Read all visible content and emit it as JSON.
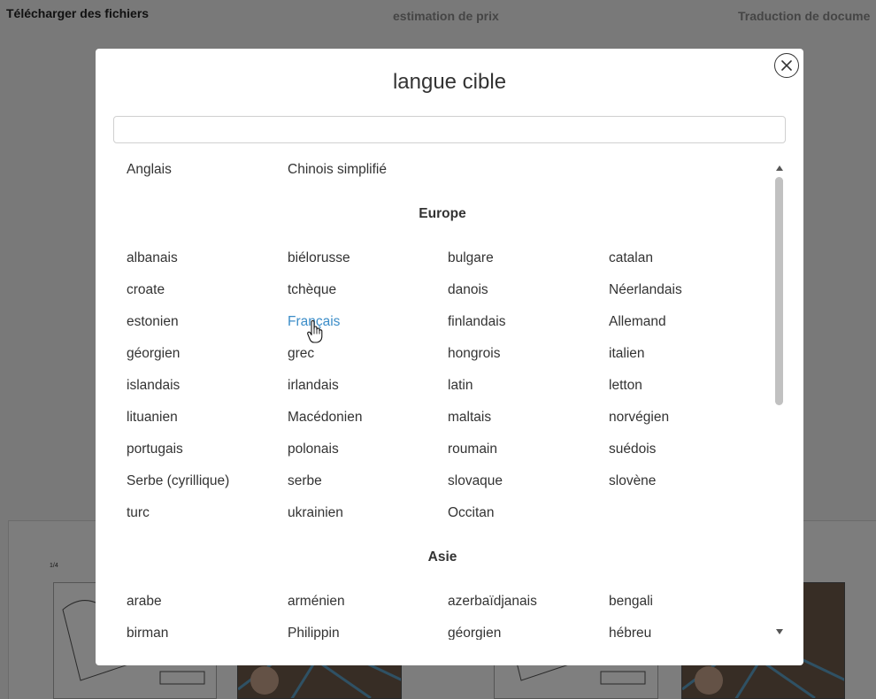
{
  "background": {
    "tabs": [
      "Télécharger des fichiers",
      "estimation de prix",
      "Traduction de docume"
    ],
    "page_number": "1/4"
  },
  "modal": {
    "title": "langue cible",
    "search": {
      "value": "",
      "placeholder": ""
    },
    "close_icon": "close-icon",
    "popular": [
      "Anglais",
      "Chinois simplifié"
    ],
    "sections": [
      {
        "title": "Europe",
        "rows": [
          [
            "albanais",
            "biélorusse",
            "bulgare",
            "catalan"
          ],
          [
            "croate",
            "tchèque",
            "danois",
            "Néerlandais"
          ],
          [
            "estonien",
            "Français",
            "finlandais",
            "Allemand"
          ],
          [
            "géorgien",
            "grec",
            "hongrois",
            "italien"
          ],
          [
            "islandais",
            "irlandais",
            "latin",
            "letton"
          ],
          [
            "lituanien",
            "Macédonien",
            "maltais",
            "norvégien"
          ],
          [
            "portugais",
            "polonais",
            "roumain",
            "suédois"
          ],
          [
            "Serbe (cyrillique)",
            "serbe",
            "slovaque",
            "slovène"
          ],
          [
            "turc",
            "ukrainien",
            "Occitan"
          ]
        ]
      },
      {
        "title": "Asie",
        "rows": [
          [
            "arabe",
            "arménien",
            "azerbaïdjanais",
            "bengali"
          ],
          [
            "birman",
            "Philippin",
            "géorgien",
            "hébreu"
          ]
        ]
      }
    ],
    "hovered_language": "Français",
    "colors": {
      "link_hover": "#3c8dc8",
      "text": "#333333",
      "overlay": "rgba(0,0,0,0.5)"
    }
  }
}
